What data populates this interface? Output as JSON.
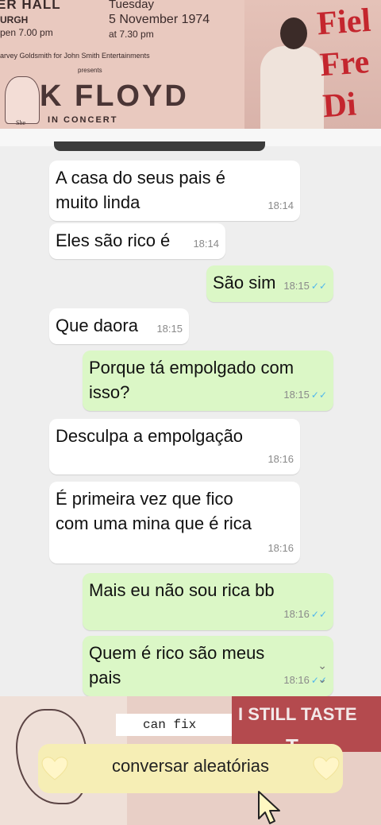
{
  "banner": {
    "poster": {
      "venue": "ER HALL",
      "city": "URGH",
      "doors": "pen 7.00 pm",
      "weekday": "Tuesday",
      "date": "5 November 1974",
      "time": "at 7.30 pm",
      "promoter": "arvey Goldsmith for John Smith Entertainments",
      "presents": "presents",
      "band": "K FLOYD",
      "in_concert": "IN CONCERT",
      "she": "She"
    },
    "photo_title": "Fiel Fre Di"
  },
  "chat": {
    "colors": {
      "incoming": "#ffffff",
      "outgoing": "#dbf7c6",
      "read_ticks": "#4fb6ec",
      "background": "#eeeeee"
    },
    "messages": [
      {
        "dir": "in",
        "text_lines": [
          "A casa do seus pais é",
          "muito linda"
        ],
        "time": "18:14"
      },
      {
        "dir": "in",
        "text_lines": [
          "Eles são rico é"
        ],
        "time": "18:14"
      },
      {
        "dir": "out",
        "text_lines": [
          "São sim"
        ],
        "time": "18:15",
        "status": "read"
      },
      {
        "dir": "in",
        "text_lines": [
          "Que daora"
        ],
        "time": "18:15"
      },
      {
        "dir": "out",
        "text_lines": [
          "Porque tá empolgado com",
          "isso?"
        ],
        "time": "18:15",
        "status": "read"
      },
      {
        "dir": "in",
        "text_lines": [
          "Desculpa a empolgação"
        ],
        "time": "18:16"
      },
      {
        "dir": "in",
        "text_lines": [
          "É primeira vez que fico",
          "com uma mina que é rica"
        ],
        "time": "18:16"
      },
      {
        "dir": "out",
        "text_lines": [
          "Mais eu não sou rica bb"
        ],
        "time": "18:16",
        "status": "read"
      },
      {
        "dir": "out",
        "text_lines": [
          "Quem é rico são meus",
          "pais"
        ],
        "time": "18:16",
        "status": "read"
      }
    ],
    "tick_glyph": "✓✓",
    "scroll_icon": "double-chevron-down-icon"
  },
  "bottom": {
    "sticker": "can fix",
    "red_text_1": "I STILL TASTE",
    "red_text_2": "T",
    "caption": "conversar aleatórias",
    "heart_color": "#fff6c8"
  }
}
